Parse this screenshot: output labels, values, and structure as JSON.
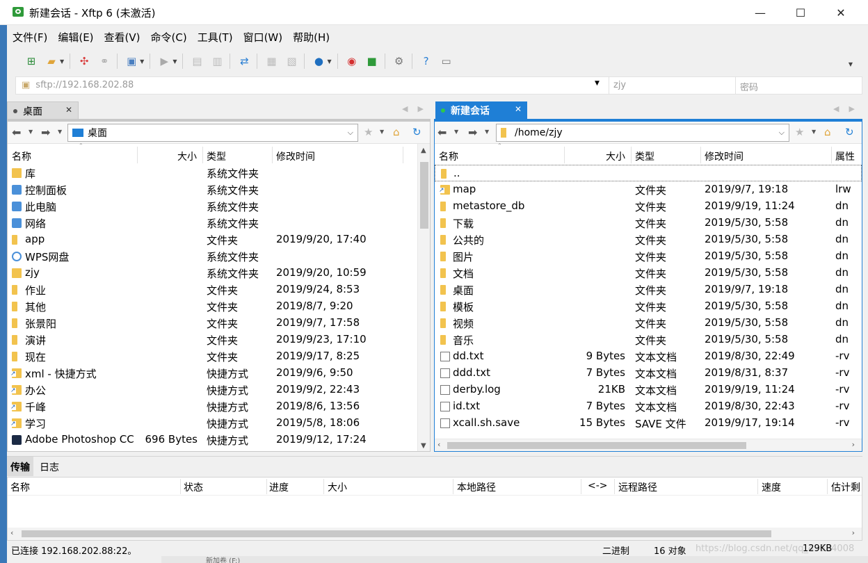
{
  "window": {
    "title": "新建会话 - Xftp 6 (未激活)",
    "minimize": "—",
    "maximize": "☐",
    "close": "✕"
  },
  "menu": [
    "文件(F)",
    "编辑(E)",
    "查看(V)",
    "命令(C)",
    "工具(T)",
    "窗口(W)",
    "帮助(H)"
  ],
  "address": {
    "url": "sftp://192.168.202.88",
    "username_placeholder": "zjy",
    "password_placeholder": "密码"
  },
  "left_panel": {
    "tab": "桌面",
    "path": "桌面",
    "columns": [
      "名称",
      "大小",
      "类型",
      "修改时间"
    ],
    "rows": [
      {
        "name": "库",
        "size": "",
        "type": "系统文件夹",
        "modified": "",
        "icon": "library"
      },
      {
        "name": "控制面板",
        "size": "",
        "type": "系统文件夹",
        "modified": "",
        "icon": "control-panel"
      },
      {
        "name": "此电脑",
        "size": "",
        "type": "系统文件夹",
        "modified": "",
        "icon": "computer"
      },
      {
        "name": "网络",
        "size": "",
        "type": "系统文件夹",
        "modified": "",
        "icon": "network"
      },
      {
        "name": "app",
        "size": "",
        "type": "文件夹",
        "modified": "2019/9/20, 17:40",
        "icon": "folder"
      },
      {
        "name": "WPS网盘",
        "size": "",
        "type": "系统文件夹",
        "modified": "",
        "icon": "cloud"
      },
      {
        "name": "zjy",
        "size": "",
        "type": "系统文件夹",
        "modified": "2019/9/20, 10:59",
        "icon": "user"
      },
      {
        "name": "作业",
        "size": "",
        "type": "文件夹",
        "modified": "2019/9/24, 8:53",
        "icon": "folder"
      },
      {
        "name": "其他",
        "size": "",
        "type": "文件夹",
        "modified": "2019/8/7, 9:20",
        "icon": "folder"
      },
      {
        "name": "张景阳",
        "size": "",
        "type": "文件夹",
        "modified": "2019/9/7, 17:58",
        "icon": "folder"
      },
      {
        "name": "演讲",
        "size": "",
        "type": "文件夹",
        "modified": "2019/9/23, 17:10",
        "icon": "folder"
      },
      {
        "name": "现在",
        "size": "",
        "type": "文件夹",
        "modified": "2019/9/17, 8:25",
        "icon": "folder"
      },
      {
        "name": "xml - 快捷方式",
        "size": "",
        "type": "快捷方式",
        "modified": "2019/9/6, 9:50",
        "icon": "shortcut"
      },
      {
        "name": "办公",
        "size": "",
        "type": "快捷方式",
        "modified": "2019/9/2, 22:43",
        "icon": "shortcut"
      },
      {
        "name": "千峰",
        "size": "",
        "type": "快捷方式",
        "modified": "2019/8/6, 13:56",
        "icon": "shortcut"
      },
      {
        "name": "学习",
        "size": "",
        "type": "快捷方式",
        "modified": "2019/5/8, 18:06",
        "icon": "shortcut"
      },
      {
        "name": "Adobe Photoshop CC",
        "size": "696 Bytes",
        "type": "快捷方式",
        "modified": "2019/9/12, 17:24",
        "icon": "photoshop"
      }
    ]
  },
  "right_panel": {
    "tab": "新建会话",
    "path": "/home/zjy",
    "columns": [
      "名称",
      "大小",
      "类型",
      "修改时间",
      "属性"
    ],
    "rows": [
      {
        "name": "..",
        "size": "",
        "type": "",
        "modified": "",
        "attr": "",
        "icon": "folder"
      },
      {
        "name": "map",
        "size": "",
        "type": "文件夹",
        "modified": "2019/9/7, 19:18",
        "attr": "lrw",
        "icon": "shortcut"
      },
      {
        "name": "metastore_db",
        "size": "",
        "type": "文件夹",
        "modified": "2019/9/19, 11:24",
        "attr": "dn",
        "icon": "folder"
      },
      {
        "name": "下载",
        "size": "",
        "type": "文件夹",
        "modified": "2019/5/30, 5:58",
        "attr": "dn",
        "icon": "folder"
      },
      {
        "name": "公共的",
        "size": "",
        "type": "文件夹",
        "modified": "2019/5/30, 5:58",
        "attr": "dn",
        "icon": "folder"
      },
      {
        "name": "图片",
        "size": "",
        "type": "文件夹",
        "modified": "2019/5/30, 5:58",
        "attr": "dn",
        "icon": "folder"
      },
      {
        "name": "文档",
        "size": "",
        "type": "文件夹",
        "modified": "2019/5/30, 5:58",
        "attr": "dn",
        "icon": "folder"
      },
      {
        "name": "桌面",
        "size": "",
        "type": "文件夹",
        "modified": "2019/9/7, 19:18",
        "attr": "dn",
        "icon": "folder"
      },
      {
        "name": "模板",
        "size": "",
        "type": "文件夹",
        "modified": "2019/5/30, 5:58",
        "attr": "dn",
        "icon": "folder"
      },
      {
        "name": "视频",
        "size": "",
        "type": "文件夹",
        "modified": "2019/5/30, 5:58",
        "attr": "dn",
        "icon": "folder"
      },
      {
        "name": "音乐",
        "size": "",
        "type": "文件夹",
        "modified": "2019/5/30, 5:58",
        "attr": "dn",
        "icon": "folder"
      },
      {
        "name": "dd.txt",
        "size": "9 Bytes",
        "type": "文本文档",
        "modified": "2019/8/30, 22:49",
        "attr": "-rv",
        "icon": "file"
      },
      {
        "name": "ddd.txt",
        "size": "7 Bytes",
        "type": "文本文档",
        "modified": "2019/8/31, 8:37",
        "attr": "-rv",
        "icon": "file"
      },
      {
        "name": "derby.log",
        "size": "21KB",
        "type": "文本文档",
        "modified": "2019/9/19, 11:24",
        "attr": "-rv",
        "icon": "file"
      },
      {
        "name": "id.txt",
        "size": "7 Bytes",
        "type": "文本文档",
        "modified": "2019/8/30, 22:43",
        "attr": "-rv",
        "icon": "file"
      },
      {
        "name": "xcall.sh.save",
        "size": "15 Bytes",
        "type": "SAVE 文件",
        "modified": "2019/9/17, 19:14",
        "attr": "-rv",
        "icon": "blank"
      }
    ]
  },
  "transfer": {
    "tabs": [
      "传输",
      "日志"
    ],
    "columns": [
      "名称",
      "状态",
      "进度",
      "大小",
      "本地路径",
      "<->",
      "远程路径",
      "速度",
      "估计剩"
    ]
  },
  "status": {
    "connection": "已连接 192.168.202.88:22。",
    "mode": "二进制",
    "objects": "16 对象",
    "size": "129KB",
    "watermark": "https://blog.csdn.net/qq_43684008",
    "behind": "新加卷 (F:)"
  }
}
